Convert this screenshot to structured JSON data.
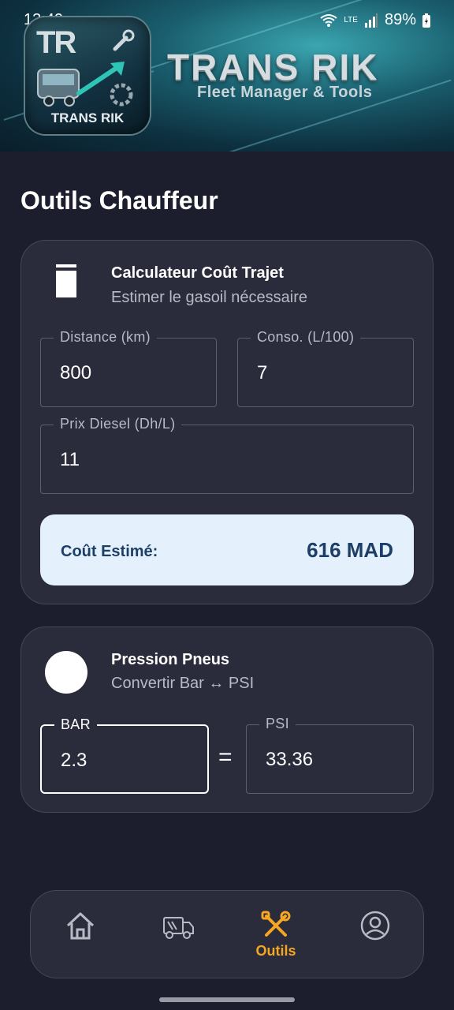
{
  "status_bar": {
    "time": "13:40",
    "battery": "89%",
    "network": "LTE"
  },
  "header": {
    "logo_mark": "TR",
    "logo_name": "TRANS RIK",
    "brand_title": "TRANS RIK",
    "brand_subtitle": "Fleet Manager & Tools"
  },
  "page": {
    "title": "Outils Chauffeur"
  },
  "trip_cost": {
    "title": "Calculateur Coût Trajet",
    "subtitle": "Estimer le gasoil nécessaire",
    "distance": {
      "label": "Distance (km)",
      "value": "800"
    },
    "consumption": {
      "label": "Conso. (L/100)",
      "value": "7"
    },
    "diesel_price": {
      "label": "Prix Diesel (Dh/L)",
      "value": "11"
    },
    "result_label": "Coût Estimé:",
    "result_value": "616 MAD"
  },
  "tire_pressure": {
    "title": "Pression Pneus",
    "subtitle": "Convertir Bar ↔ PSI",
    "bar": {
      "label": "BAR",
      "value": "2.3"
    },
    "equals": "=",
    "psi": {
      "label": "PSI",
      "value": "33.36"
    }
  },
  "bottom_nav": {
    "items": [
      {
        "icon": "home-icon",
        "label": ""
      },
      {
        "icon": "truck-icon",
        "label": ""
      },
      {
        "icon": "tools-icon",
        "label": "Outils",
        "active": true
      },
      {
        "icon": "profile-icon",
        "label": ""
      }
    ],
    "active_color": "#f5a623"
  }
}
